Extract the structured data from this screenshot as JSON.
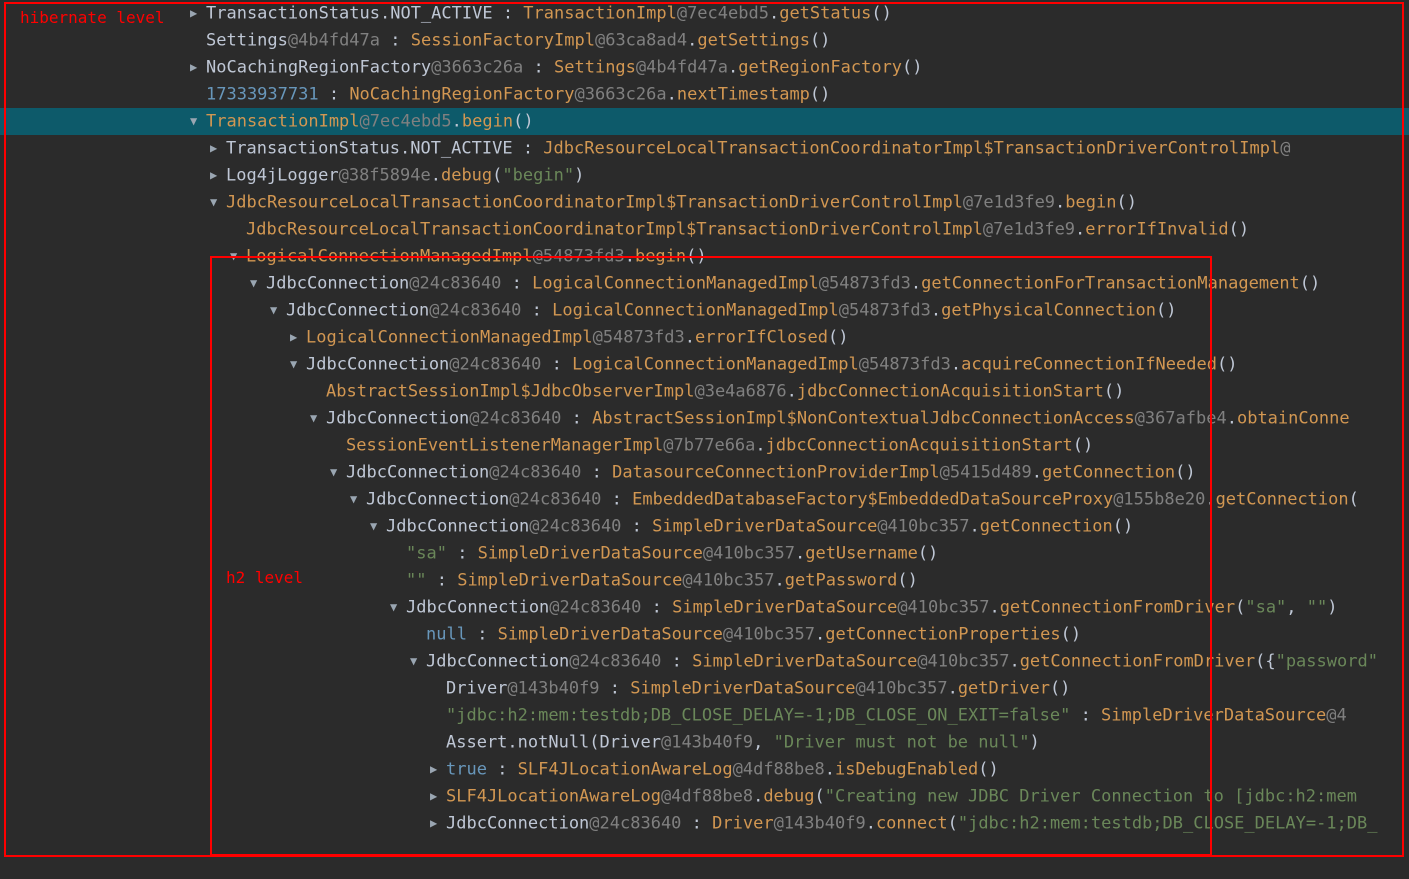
{
  "annotations": {
    "hibernate_label": "hibernate level",
    "h2_label": "h2 level"
  },
  "rows": [
    {
      "depth": 0,
      "arrow": "r",
      "selected": false,
      "tokens": [
        {
          "t": "TransactionStatus.NOT_ACTIVE",
          "c": "white"
        },
        {
          "t": " : ",
          "c": "white"
        },
        {
          "t": "TransactionImpl",
          "c": "keyword"
        },
        {
          "t": "@7ec4ebd5",
          "c": "hash"
        },
        {
          "t": ".",
          "c": "white"
        },
        {
          "t": "getStatus",
          "c": "keyword"
        },
        {
          "t": "()",
          "c": "white"
        }
      ]
    },
    {
      "depth": 0,
      "arrow": "",
      "selected": false,
      "tokens": [
        {
          "t": "Settings",
          "c": "white"
        },
        {
          "t": "@4b4fd47a",
          "c": "hash"
        },
        {
          "t": " : ",
          "c": "white"
        },
        {
          "t": "SessionFactoryImpl",
          "c": "keyword"
        },
        {
          "t": "@63ca8ad4",
          "c": "hash"
        },
        {
          "t": ".",
          "c": "white"
        },
        {
          "t": "getSettings",
          "c": "keyword"
        },
        {
          "t": "()",
          "c": "white"
        }
      ]
    },
    {
      "depth": 0,
      "arrow": "r",
      "selected": false,
      "tokens": [
        {
          "t": "NoCachingRegionFactory",
          "c": "white"
        },
        {
          "t": "@3663c26a",
          "c": "hash"
        },
        {
          "t": " : ",
          "c": "white"
        },
        {
          "t": "Settings",
          "c": "keyword"
        },
        {
          "t": "@4b4fd47a",
          "c": "hash"
        },
        {
          "t": ".",
          "c": "white"
        },
        {
          "t": "getRegionFactory",
          "c": "keyword"
        },
        {
          "t": "()",
          "c": "white"
        }
      ]
    },
    {
      "depth": 0,
      "arrow": "",
      "selected": false,
      "tokens": [
        {
          "t": "17333937731",
          "c": "num"
        },
        {
          "t": " : ",
          "c": "white"
        },
        {
          "t": "NoCachingRegionFactory",
          "c": "keyword"
        },
        {
          "t": "@3663c26a",
          "c": "hash"
        },
        {
          "t": ".",
          "c": "white"
        },
        {
          "t": "nextTimestamp",
          "c": "keyword"
        },
        {
          "t": "()",
          "c": "white"
        }
      ]
    },
    {
      "depth": 0,
      "arrow": "d",
      "selected": true,
      "tokens": [
        {
          "t": "TransactionImpl",
          "c": "keyword"
        },
        {
          "t": "@7ec4ebd5",
          "c": "hash"
        },
        {
          "t": ".",
          "c": "white"
        },
        {
          "t": "begin",
          "c": "keyword"
        },
        {
          "t": "()",
          "c": "white"
        }
      ]
    },
    {
      "depth": 1,
      "arrow": "r",
      "selected": false,
      "tokens": [
        {
          "t": "TransactionStatus.NOT_ACTIVE",
          "c": "white"
        },
        {
          "t": " : ",
          "c": "white"
        },
        {
          "t": "JdbcResourceLocalTransactionCoordinatorImpl$TransactionDriverControlImpl",
          "c": "keyword"
        },
        {
          "t": "@",
          "c": "hash"
        }
      ]
    },
    {
      "depth": 1,
      "arrow": "r",
      "selected": false,
      "tokens": [
        {
          "t": "Log4jLogger",
          "c": "white"
        },
        {
          "t": "@38f5894e",
          "c": "hash"
        },
        {
          "t": ".",
          "c": "white"
        },
        {
          "t": "debug",
          "c": "keyword"
        },
        {
          "t": "(",
          "c": "white"
        },
        {
          "t": "\"begin\"",
          "c": "str"
        },
        {
          "t": ")",
          "c": "white"
        }
      ]
    },
    {
      "depth": 1,
      "arrow": "d",
      "selected": false,
      "tokens": [
        {
          "t": "JdbcResourceLocalTransactionCoordinatorImpl$TransactionDriverControlImpl",
          "c": "keyword"
        },
        {
          "t": "@7e1d3fe9",
          "c": "hash"
        },
        {
          "t": ".",
          "c": "white"
        },
        {
          "t": "begin",
          "c": "keyword"
        },
        {
          "t": "()",
          "c": "white"
        }
      ]
    },
    {
      "depth": 2,
      "arrow": "",
      "selected": false,
      "tokens": [
        {
          "t": "JdbcResourceLocalTransactionCoordinatorImpl$TransactionDriverControlImpl",
          "c": "keyword"
        },
        {
          "t": "@7e1d3fe9",
          "c": "hash"
        },
        {
          "t": ".",
          "c": "white"
        },
        {
          "t": "errorIfInvalid",
          "c": "keyword"
        },
        {
          "t": "()",
          "c": "white"
        }
      ]
    },
    {
      "depth": 2,
      "arrow": "d",
      "selected": false,
      "tokens": [
        {
          "t": "LogicalConnectionManagedImpl",
          "c": "keyword"
        },
        {
          "t": "@54873fd3",
          "c": "hash"
        },
        {
          "t": ".",
          "c": "white"
        },
        {
          "t": "begin",
          "c": "keyword"
        },
        {
          "t": "()",
          "c": "white"
        }
      ]
    },
    {
      "depth": 3,
      "arrow": "d",
      "selected": false,
      "tokens": [
        {
          "t": "JdbcConnection",
          "c": "white"
        },
        {
          "t": "@24c83640",
          "c": "hash"
        },
        {
          "t": " : ",
          "c": "white"
        },
        {
          "t": "LogicalConnectionManagedImpl",
          "c": "keyword"
        },
        {
          "t": "@54873fd3",
          "c": "hash"
        },
        {
          "t": ".",
          "c": "white"
        },
        {
          "t": "getConnectionForTransactionManagement",
          "c": "keyword"
        },
        {
          "t": "()",
          "c": "white"
        }
      ]
    },
    {
      "depth": 4,
      "arrow": "d",
      "selected": false,
      "tokens": [
        {
          "t": "JdbcConnection",
          "c": "white"
        },
        {
          "t": "@24c83640",
          "c": "hash"
        },
        {
          "t": " : ",
          "c": "white"
        },
        {
          "t": "LogicalConnectionManagedImpl",
          "c": "keyword"
        },
        {
          "t": "@54873fd3",
          "c": "hash"
        },
        {
          "t": ".",
          "c": "white"
        },
        {
          "t": "getPhysicalConnection",
          "c": "keyword"
        },
        {
          "t": "()",
          "c": "white"
        }
      ]
    },
    {
      "depth": 5,
      "arrow": "r",
      "selected": false,
      "tokens": [
        {
          "t": "LogicalConnectionManagedImpl",
          "c": "keyword"
        },
        {
          "t": "@54873fd3",
          "c": "hash"
        },
        {
          "t": ".",
          "c": "white"
        },
        {
          "t": "errorIfClosed",
          "c": "keyword"
        },
        {
          "t": "()",
          "c": "white"
        }
      ]
    },
    {
      "depth": 5,
      "arrow": "d",
      "selected": false,
      "tokens": [
        {
          "t": "JdbcConnection",
          "c": "white"
        },
        {
          "t": "@24c83640",
          "c": "hash"
        },
        {
          "t": " : ",
          "c": "white"
        },
        {
          "t": "LogicalConnectionManagedImpl",
          "c": "keyword"
        },
        {
          "t": "@54873fd3",
          "c": "hash"
        },
        {
          "t": ".",
          "c": "white"
        },
        {
          "t": "acquireConnectionIfNeeded",
          "c": "keyword"
        },
        {
          "t": "()",
          "c": "white"
        }
      ]
    },
    {
      "depth": 6,
      "arrow": "",
      "selected": false,
      "tokens": [
        {
          "t": "AbstractSessionImpl$JdbcObserverImpl",
          "c": "keyword"
        },
        {
          "t": "@3e4a6876",
          "c": "hash"
        },
        {
          "t": ".",
          "c": "white"
        },
        {
          "t": "jdbcConnectionAcquisitionStart",
          "c": "keyword"
        },
        {
          "t": "()",
          "c": "white"
        }
      ]
    },
    {
      "depth": 6,
      "arrow": "d",
      "selected": false,
      "tokens": [
        {
          "t": "JdbcConnection",
          "c": "white"
        },
        {
          "t": "@24c83640",
          "c": "hash"
        },
        {
          "t": " : ",
          "c": "white"
        },
        {
          "t": "AbstractSessionImpl$NonContextualJdbcConnectionAccess",
          "c": "keyword"
        },
        {
          "t": "@367afbe4",
          "c": "hash"
        },
        {
          "t": ".",
          "c": "white"
        },
        {
          "t": "obtainConne",
          "c": "keyword"
        }
      ]
    },
    {
      "depth": 7,
      "arrow": "",
      "selected": false,
      "tokens": [
        {
          "t": "SessionEventListenerManagerImpl",
          "c": "keyword"
        },
        {
          "t": "@7b77e66a",
          "c": "hash"
        },
        {
          "t": ".",
          "c": "white"
        },
        {
          "t": "jdbcConnectionAcquisitionStart",
          "c": "keyword"
        },
        {
          "t": "()",
          "c": "white"
        }
      ]
    },
    {
      "depth": 7,
      "arrow": "d",
      "selected": false,
      "tokens": [
        {
          "t": "JdbcConnection",
          "c": "white"
        },
        {
          "t": "@24c83640",
          "c": "hash"
        },
        {
          "t": " : ",
          "c": "white"
        },
        {
          "t": "DatasourceConnectionProviderImpl",
          "c": "keyword"
        },
        {
          "t": "@5415d489",
          "c": "hash"
        },
        {
          "t": ".",
          "c": "white"
        },
        {
          "t": "getConnection",
          "c": "keyword"
        },
        {
          "t": "()",
          "c": "white"
        }
      ]
    },
    {
      "depth": 8,
      "arrow": "d",
      "selected": false,
      "tokens": [
        {
          "t": "JdbcConnection",
          "c": "white"
        },
        {
          "t": "@24c83640",
          "c": "hash"
        },
        {
          "t": " : ",
          "c": "white"
        },
        {
          "t": "EmbeddedDatabaseFactory$EmbeddedDataSourceProxy",
          "c": "keyword"
        },
        {
          "t": "@155b8e20",
          "c": "hash"
        },
        {
          "t": ".",
          "c": "white"
        },
        {
          "t": "getConnection",
          "c": "keyword"
        },
        {
          "t": "(",
          "c": "white"
        }
      ]
    },
    {
      "depth": 9,
      "arrow": "d",
      "selected": false,
      "tokens": [
        {
          "t": "JdbcConnection",
          "c": "white"
        },
        {
          "t": "@24c83640",
          "c": "hash"
        },
        {
          "t": " : ",
          "c": "white"
        },
        {
          "t": "SimpleDriverDataSource",
          "c": "keyword"
        },
        {
          "t": "@410bc357",
          "c": "hash"
        },
        {
          "t": ".",
          "c": "white"
        },
        {
          "t": "getConnection",
          "c": "keyword"
        },
        {
          "t": "()",
          "c": "white"
        }
      ]
    },
    {
      "depth": 10,
      "arrow": "",
      "selected": false,
      "tokens": [
        {
          "t": "\"sa\"",
          "c": "str"
        },
        {
          "t": " : ",
          "c": "white"
        },
        {
          "t": "SimpleDriverDataSource",
          "c": "keyword"
        },
        {
          "t": "@410bc357",
          "c": "hash"
        },
        {
          "t": ".",
          "c": "white"
        },
        {
          "t": "getUsername",
          "c": "keyword"
        },
        {
          "t": "()",
          "c": "white"
        }
      ]
    },
    {
      "depth": 10,
      "arrow": "",
      "selected": false,
      "tokens": [
        {
          "t": "\"\"",
          "c": "str"
        },
        {
          "t": " : ",
          "c": "white"
        },
        {
          "t": "SimpleDriverDataSource",
          "c": "keyword"
        },
        {
          "t": "@410bc357",
          "c": "hash"
        },
        {
          "t": ".",
          "c": "white"
        },
        {
          "t": "getPassword",
          "c": "keyword"
        },
        {
          "t": "()",
          "c": "white"
        }
      ]
    },
    {
      "depth": 10,
      "arrow": "d",
      "selected": false,
      "tokens": [
        {
          "t": "JdbcConnection",
          "c": "white"
        },
        {
          "t": "@24c83640",
          "c": "hash"
        },
        {
          "t": " : ",
          "c": "white"
        },
        {
          "t": "SimpleDriverDataSource",
          "c": "keyword"
        },
        {
          "t": "@410bc357",
          "c": "hash"
        },
        {
          "t": ".",
          "c": "white"
        },
        {
          "t": "getConnectionFromDriver",
          "c": "keyword"
        },
        {
          "t": "(",
          "c": "white"
        },
        {
          "t": "\"sa\"",
          "c": "str"
        },
        {
          "t": ", ",
          "c": "white"
        },
        {
          "t": "\"\"",
          "c": "str"
        },
        {
          "t": ")",
          "c": "white"
        }
      ]
    },
    {
      "depth": 11,
      "arrow": "",
      "selected": false,
      "tokens": [
        {
          "t": "null",
          "c": "null"
        },
        {
          "t": " : ",
          "c": "white"
        },
        {
          "t": "SimpleDriverDataSource",
          "c": "keyword"
        },
        {
          "t": "@410bc357",
          "c": "hash"
        },
        {
          "t": ".",
          "c": "white"
        },
        {
          "t": "getConnectionProperties",
          "c": "keyword"
        },
        {
          "t": "()",
          "c": "white"
        }
      ]
    },
    {
      "depth": 11,
      "arrow": "d",
      "selected": false,
      "tokens": [
        {
          "t": "JdbcConnection",
          "c": "white"
        },
        {
          "t": "@24c83640",
          "c": "hash"
        },
        {
          "t": " : ",
          "c": "white"
        },
        {
          "t": "SimpleDriverDataSource",
          "c": "keyword"
        },
        {
          "t": "@410bc357",
          "c": "hash"
        },
        {
          "t": ".",
          "c": "white"
        },
        {
          "t": "getConnectionFromDriver",
          "c": "keyword"
        },
        {
          "t": "({",
          "c": "white"
        },
        {
          "t": "\"password\"",
          "c": "str"
        }
      ]
    },
    {
      "depth": 12,
      "arrow": "",
      "selected": false,
      "tokens": [
        {
          "t": "Driver",
          "c": "white"
        },
        {
          "t": "@143b40f9",
          "c": "hash"
        },
        {
          "t": " : ",
          "c": "white"
        },
        {
          "t": "SimpleDriverDataSource",
          "c": "keyword"
        },
        {
          "t": "@410bc357",
          "c": "hash"
        },
        {
          "t": ".",
          "c": "white"
        },
        {
          "t": "getDriver",
          "c": "keyword"
        },
        {
          "t": "()",
          "c": "white"
        }
      ]
    },
    {
      "depth": 12,
      "arrow": "",
      "selected": false,
      "tokens": [
        {
          "t": "\"jdbc:h2:mem:testdb;DB_CLOSE_DELAY=-1;DB_CLOSE_ON_EXIT=false\"",
          "c": "str"
        },
        {
          "t": " : ",
          "c": "white"
        },
        {
          "t": "SimpleDriverDataSource",
          "c": "keyword"
        },
        {
          "t": "@4",
          "c": "hash"
        }
      ]
    },
    {
      "depth": 12,
      "arrow": "",
      "selected": false,
      "tokens": [
        {
          "t": "Assert.notNull",
          "c": "white"
        },
        {
          "t": "(",
          "c": "white"
        },
        {
          "t": "Driver",
          "c": "white"
        },
        {
          "t": "@143b40f9",
          "c": "hash"
        },
        {
          "t": ", ",
          "c": "white"
        },
        {
          "t": "\"Driver must not be null\"",
          "c": "str"
        },
        {
          "t": ")",
          "c": "white"
        }
      ]
    },
    {
      "depth": 12,
      "arrow": "r",
      "selected": false,
      "tokens": [
        {
          "t": "true",
          "c": "bool"
        },
        {
          "t": " : ",
          "c": "white"
        },
        {
          "t": "SLF4JLocationAwareLog",
          "c": "keyword"
        },
        {
          "t": "@4df88be8",
          "c": "hash"
        },
        {
          "t": ".",
          "c": "white"
        },
        {
          "t": "isDebugEnabled",
          "c": "keyword"
        },
        {
          "t": "()",
          "c": "white"
        }
      ]
    },
    {
      "depth": 12,
      "arrow": "r",
      "selected": false,
      "tokens": [
        {
          "t": "SLF4JLocationAwareLog",
          "c": "keyword"
        },
        {
          "t": "@4df88be8",
          "c": "hash"
        },
        {
          "t": ".",
          "c": "white"
        },
        {
          "t": "debug",
          "c": "keyword"
        },
        {
          "t": "(",
          "c": "white"
        },
        {
          "t": "\"Creating new JDBC Driver Connection to [jdbc:h2:mem",
          "c": "str"
        }
      ]
    },
    {
      "depth": 12,
      "arrow": "r",
      "selected": false,
      "tokens": [
        {
          "t": "JdbcConnection",
          "c": "white"
        },
        {
          "t": "@24c83640",
          "c": "hash"
        },
        {
          "t": " : ",
          "c": "white"
        },
        {
          "t": "Driver",
          "c": "keyword"
        },
        {
          "t": "@143b40f9",
          "c": "hash"
        },
        {
          "t": ".",
          "c": "white"
        },
        {
          "t": "connect",
          "c": "keyword"
        },
        {
          "t": "(",
          "c": "white"
        },
        {
          "t": "\"jdbc:h2:mem:testdb;DB_CLOSE_DELAY=-1;DB_",
          "c": "str"
        }
      ]
    }
  ]
}
